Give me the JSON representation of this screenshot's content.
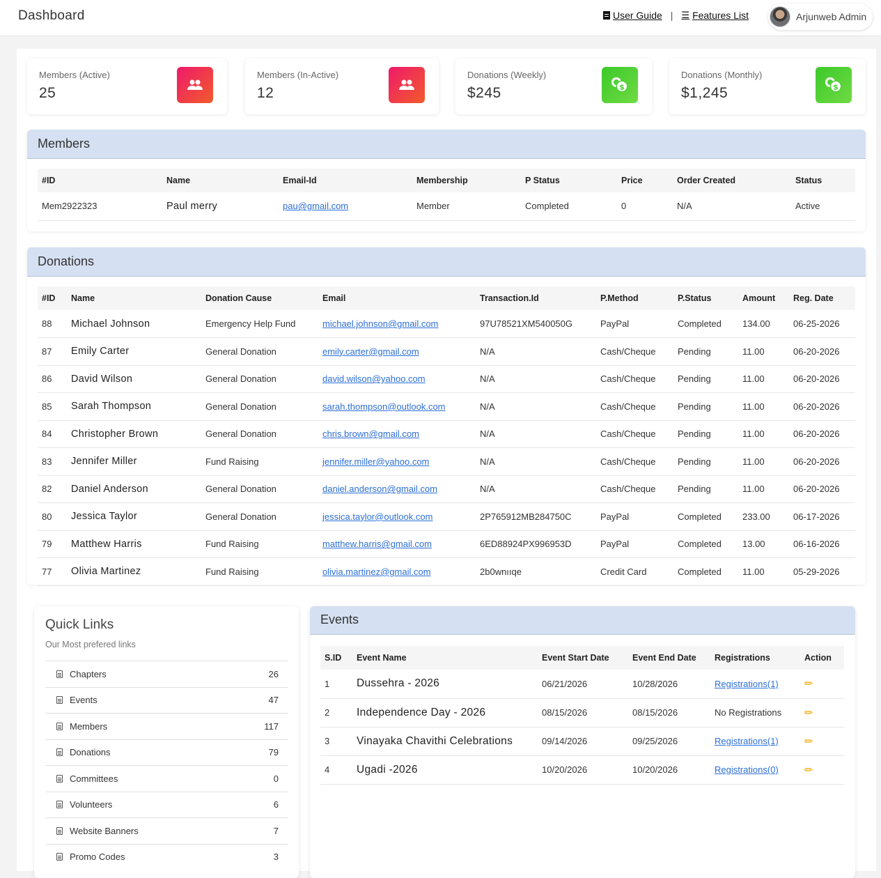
{
  "header": {
    "title": "Dashboard",
    "user_guide": "User Guide",
    "separator": "|",
    "features_list": "Features List",
    "user_name": "Arjunweb Admin"
  },
  "stats": [
    {
      "label": "Members (Active)",
      "value": "25",
      "icon": "users-icon"
    },
    {
      "label": "Members (In-Active)",
      "value": "12",
      "icon": "users-icon"
    },
    {
      "label": "Donations (Weekly)",
      "value": "$245",
      "icon": "coins-dollar-icon"
    },
    {
      "label": "Donations (Monthly)",
      "value": "$1,245",
      "icon": "coins-dollar-icon"
    }
  ],
  "members": {
    "title": "Members",
    "columns": [
      "#ID",
      "Name",
      "Email-Id",
      "Membership",
      "P Status",
      "Price",
      "Order Created",
      "Status"
    ],
    "rows": [
      {
        "id": "Mem2922323",
        "name": "Paul merry",
        "email": "pau@gmail.com",
        "membership": "Member",
        "p_status": "Completed",
        "price": "0",
        "order_created": "N/A",
        "status": "Active"
      }
    ]
  },
  "donations": {
    "title": "Donations",
    "columns": [
      "#ID",
      "Name",
      "Donation Cause",
      "Email",
      "Transaction.Id",
      "P.Method",
      "P.Status",
      "Amount",
      "Reg. Date"
    ],
    "rows": [
      {
        "id": "88",
        "name": "Michael Johnson",
        "cause": "Emergency Help Fund",
        "email": "michael.johnson@gmail.com",
        "txn": "97U78521XM540050G",
        "method": "PayPal",
        "status": "Completed",
        "amount": "134.00",
        "date": "06-25-2026"
      },
      {
        "id": "87",
        "name": "Emily Carter",
        "cause": "General Donation",
        "email": "emily.carter@gmail.com",
        "txn": "N/A",
        "method": "Cash/Cheque",
        "status": "Pending",
        "amount": "11.00",
        "date": "06-20-2026"
      },
      {
        "id": "86",
        "name": "David Wilson",
        "cause": "General Donation",
        "email": "david.wilson@yahoo.com",
        "txn": "N/A",
        "method": "Cash/Cheque",
        "status": "Pending",
        "amount": "11.00",
        "date": "06-20-2026"
      },
      {
        "id": "85",
        "name": "Sarah Thompson",
        "cause": "General Donation",
        "email": "sarah.thompson@outlook.com",
        "txn": "N/A",
        "method": "Cash/Cheque",
        "status": "Pending",
        "amount": "11.00",
        "date": "06-20-2026"
      },
      {
        "id": "84",
        "name": "Christopher Brown",
        "cause": "General Donation",
        "email": "chris.brown@gmail.com",
        "txn": "N/A",
        "method": "Cash/Cheque",
        "status": "Pending",
        "amount": "11.00",
        "date": "06-20-2026"
      },
      {
        "id": "83",
        "name": "Jennifer Miller",
        "cause": "Fund Raising",
        "email": "jennifer.miller@yahoo.com",
        "txn": "N/A",
        "method": "Cash/Cheque",
        "status": "Pending",
        "amount": "11.00",
        "date": "06-20-2026"
      },
      {
        "id": "82",
        "name": "Daniel Anderson",
        "cause": "General Donation",
        "email": "daniel.anderson@gmail.com",
        "txn": "N/A",
        "method": "Cash/Cheque",
        "status": "Pending",
        "amount": "11.00",
        "date": "06-20-2026"
      },
      {
        "id": "80",
        "name": "Jessica Taylor",
        "cause": "General Donation",
        "email": "jessica.taylor@outlook.com",
        "txn": "2P765912MB284750C",
        "method": "PayPal",
        "status": "Completed",
        "amount": "233.00",
        "date": "06-17-2026"
      },
      {
        "id": "79",
        "name": "Matthew Harris",
        "cause": "Fund Raising",
        "email": "matthew.harris@gmail.com",
        "txn": "6ED88924PX996953D",
        "method": "PayPal",
        "status": "Completed",
        "amount": "13.00",
        "date": "06-16-2026"
      },
      {
        "id": "77",
        "name": "Olivia Martinez",
        "cause": "Fund Raising",
        "email": "olivia.martinez@gmail.com",
        "txn": "2b0wnııqe",
        "method": "Credit Card",
        "status": "Completed",
        "amount": "11.00",
        "date": "05-29-2026"
      }
    ]
  },
  "quick_links": {
    "title": "Quick Links",
    "subtitle": "Our Most prefered links",
    "items": [
      {
        "label": "Chapters",
        "count": "26"
      },
      {
        "label": "Events",
        "count": "47"
      },
      {
        "label": "Members",
        "count": "117"
      },
      {
        "label": "Donations",
        "count": "79"
      },
      {
        "label": "Committees",
        "count": "0"
      },
      {
        "label": "Volunteers",
        "count": "6"
      },
      {
        "label": "Website Banners",
        "count": "7"
      },
      {
        "label": "Promo Codes",
        "count": "3"
      }
    ]
  },
  "events": {
    "title": "Events",
    "columns": [
      "S.ID",
      "Event Name",
      "Event Start Date",
      "Event End Date",
      "Registrations",
      "Action"
    ],
    "rows": [
      {
        "sid": "1",
        "name": "Dussehra - 2026",
        "start": "06/21/2026",
        "end": "10/28/2026",
        "registrations": "Registrations(1)",
        "reg_link": true
      },
      {
        "sid": "2",
        "name": "Independence Day - 2026",
        "start": "08/15/2026",
        "end": "08/15/2026",
        "registrations": "No Registrations",
        "reg_link": false
      },
      {
        "sid": "3",
        "name": "Vinayaka Chavithi Celebrations",
        "start": "09/14/2026",
        "end": "09/25/2026",
        "registrations": "Registrations(1)",
        "reg_link": true
      },
      {
        "sid": "4",
        "name": "Ugadi -2026",
        "start": "10/20/2026",
        "end": "10/20/2026",
        "registrations": "Registrations(0)",
        "reg_link": true
      }
    ]
  },
  "colors": {
    "panel_header": "#d5e0f2",
    "link": "#2d6fd6",
    "icon_red": "#ee1a6b",
    "icon_green": "#3cc92a",
    "pencil": "#f0a500"
  }
}
